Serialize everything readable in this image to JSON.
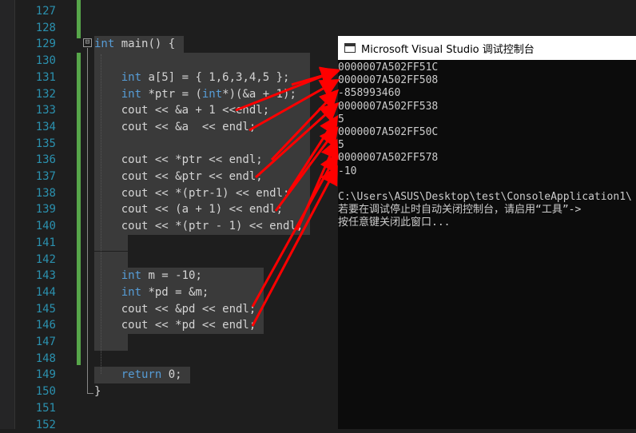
{
  "editor": {
    "line_numbers": [
      "127",
      "128",
      "129",
      "130",
      "131",
      "132",
      "133",
      "134",
      "135",
      "136",
      "137",
      "138",
      "139",
      "140",
      "141",
      "142",
      "143",
      "144",
      "145",
      "146",
      "147",
      "148",
      "149",
      "150",
      "151",
      "152"
    ],
    "fold_toggle": "⊟",
    "lines": [
      {
        "num": "129",
        "parts": [
          {
            "t": "int",
            "kw": true
          },
          {
            "t": " main() {"
          }
        ]
      },
      {
        "num": "131",
        "parts": [
          {
            "t": "    "
          },
          {
            "t": "int",
            "kw": true
          },
          {
            "t": " a[5] = { 1,6,3,4,5 };"
          }
        ]
      },
      {
        "num": "132",
        "parts": [
          {
            "t": "    "
          },
          {
            "t": "int",
            "kw": true
          },
          {
            "t": " *ptr = ("
          },
          {
            "t": "int",
            "kw": true
          },
          {
            "t": "*)(&a + 1);"
          }
        ]
      },
      {
        "num": "133",
        "parts": [
          {
            "t": "    cout << &a + 1 <<endl;"
          }
        ]
      },
      {
        "num": "134",
        "parts": [
          {
            "t": "    cout << &a  << endl;"
          }
        ]
      },
      {
        "num": "136",
        "parts": [
          {
            "t": "    cout << *ptr << endl;"
          }
        ]
      },
      {
        "num": "137",
        "parts": [
          {
            "t": "    cout << &ptr << endl;"
          }
        ]
      },
      {
        "num": "138",
        "parts": [
          {
            "t": "    cout << *(ptr-1) << endl;"
          }
        ]
      },
      {
        "num": "139",
        "parts": [
          {
            "t": "    cout << (a + 1) << endl;"
          }
        ]
      },
      {
        "num": "140",
        "parts": [
          {
            "t": "    cout << *(ptr - 1) << endl;"
          }
        ]
      },
      {
        "num": "143",
        "parts": [
          {
            "t": "    "
          },
          {
            "t": "int",
            "kw": true
          },
          {
            "t": " m = -10;"
          }
        ]
      },
      {
        "num": "144",
        "parts": [
          {
            "t": "    "
          },
          {
            "t": "int",
            "kw": true
          },
          {
            "t": " *pd = &m;"
          }
        ]
      },
      {
        "num": "145",
        "parts": [
          {
            "t": "    cout << &pd << endl;"
          }
        ]
      },
      {
        "num": "146",
        "parts": [
          {
            "t": "    cout << *pd << endl;"
          }
        ]
      },
      {
        "num": "149",
        "parts": [
          {
            "t": "    "
          },
          {
            "t": "return",
            "kw": true
          },
          {
            "t": " 0;"
          }
        ]
      },
      {
        "num": "150",
        "parts": [
          {
            "t": "}"
          }
        ]
      }
    ]
  },
  "console": {
    "title": "Microsoft Visual Studio 调试控制台",
    "lines": [
      "0000007A502FF51C",
      "0000007A502FF508",
      "-858993460",
      "0000007A502FF538",
      "5",
      "0000007A502FF50C",
      "5",
      "0000007A502FF578",
      "-10",
      "",
      "C:\\Users\\ASUS\\Desktop\\test\\ConsoleApplication1\\",
      "若要在调试停止时自动关闭控制台，请启用“工具”->",
      "按任意键关闭此窗口..."
    ]
  },
  "colors": {
    "line_number": "#2b91af",
    "keyword": "#569cd6",
    "code_text": "#d4d4d4",
    "selection": "#3a3a3a",
    "change_bar": "#57a64a",
    "arrow": "#ff0000",
    "console_text": "#cccccc"
  }
}
